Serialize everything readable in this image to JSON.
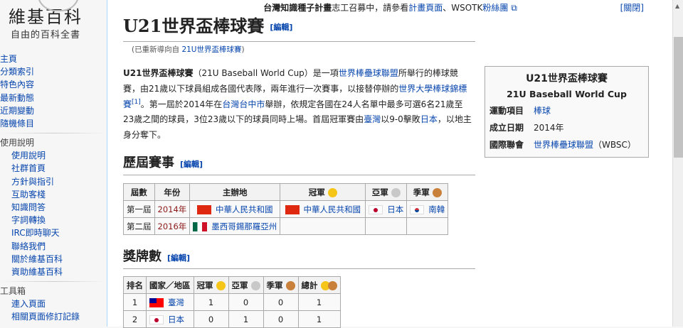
{
  "logo": {
    "title": "維基百科",
    "subtitle": "自由的百科全書"
  },
  "sidebar": {
    "main": [
      "主頁",
      "分類索引",
      "特色內容",
      "最新動態",
      "近期變動",
      "隨機條目"
    ],
    "help_heading": "使用說明",
    "help": [
      "使用說明",
      "社群首頁",
      "方針與指引",
      "互助客棧",
      "知識問答",
      "字詞轉換",
      "IRC即時聊天",
      "聯絡我們",
      "關於維基百科",
      "資助維基百科"
    ],
    "tools_heading": "工具箱",
    "tools": [
      "連入頁面",
      "相關頁面修訂記錄"
    ]
  },
  "notice": {
    "bold": "台灣知識種子計畫",
    "text": "志工召募中，請參看",
    "link1": "計畫頁面",
    "sep": "、WSOTK",
    "link2": "粉絲團",
    "close": "[關閉]"
  },
  "page": {
    "title": "U21世界盃棒球賽",
    "edit": "[編輯]",
    "redirect_prefix": "(已重新導向自 ",
    "redirect_link": "21U世界盃棒球賽",
    "redirect_suffix": ")"
  },
  "lead": {
    "p1_bold": "U21世界盃棒球賽",
    "p2": "（21U Baseball World Cup）是一項",
    "l1": "世界棒壘球聯盟",
    "p3": "所舉行的棒球競賽，由21歲以下球員組成各國代表隊，兩年進行一次賽事，以接替停辦的",
    "l2": "世界大學棒球錦標賽",
    "ref": "[1]",
    "p4": "。第一屆於2014年在",
    "l3": "台灣",
    "l4": "台中市",
    "p5": "舉辦，依規定各國在24人名單中最多可選6名21歲至23歲之間的球員，3位23歲以下的球員同時上場。首屆冠軍賽由",
    "l5": "臺灣",
    "p6": "以9-0擊敗",
    "l6": "日本",
    "p7": "，以地主身分奪下。"
  },
  "infobox": {
    "title": "U21世界盃棒球賽",
    "subtitle": "21U Baseball World Cup",
    "rows": [
      {
        "k": "運動項目",
        "v": "棒球"
      },
      {
        "k": "成立日期",
        "v": "2014年"
      },
      {
        "k": "國際聯會",
        "v": "世界棒壘球聯盟",
        "extra": "（WBSC）"
      }
    ]
  },
  "history": {
    "heading": "歷屆賽事",
    "edit": "[編輯]",
    "headers": [
      "屆數",
      "年份",
      "主辦地",
      "冠軍",
      "亞軍",
      "季軍"
    ],
    "rows": [
      [
        "第一屆",
        "2014年",
        "中華人民共和國",
        "中華人民共和國",
        "日本",
        "南韓"
      ],
      [
        "第二屆",
        "2016年",
        "墨西哥錫那羅亞州",
        "",
        "",
        ""
      ]
    ]
  },
  "medals": {
    "heading": "獎牌數",
    "edit": "[編輯]",
    "headers": [
      "排名",
      "國家／地區",
      "冠軍",
      "亞軍",
      "季軍",
      "總計"
    ],
    "rows": [
      [
        "1",
        "臺灣",
        "1",
        "0",
        "0",
        "1"
      ],
      [
        "2",
        "日本",
        "0",
        "1",
        "0",
        "1"
      ]
    ]
  }
}
